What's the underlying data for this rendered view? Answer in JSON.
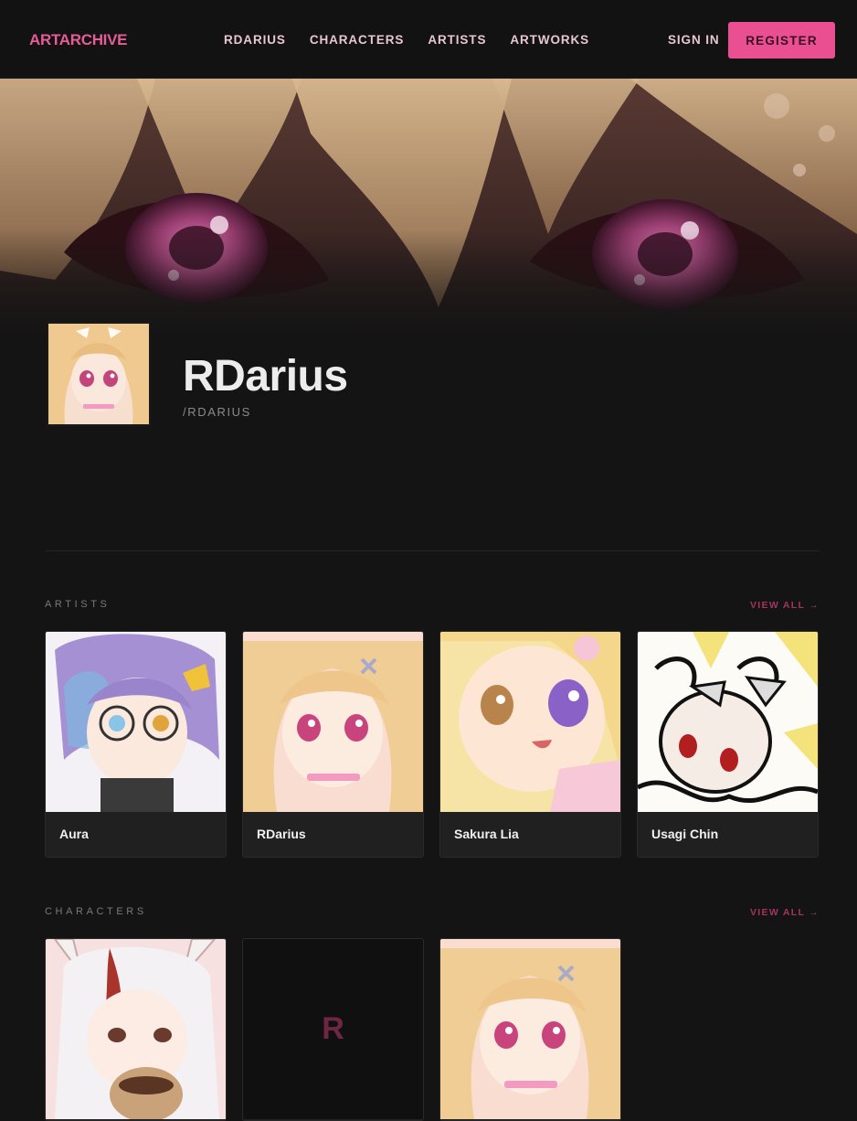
{
  "brand": {
    "name": "ARTARCHIVE",
    "accent": "#ea4f91"
  },
  "nav": {
    "items": [
      {
        "label": "RDARIUS"
      },
      {
        "label": "CHARACTERS"
      },
      {
        "label": "ARTISTS"
      },
      {
        "label": "ARTWORKS"
      }
    ],
    "sign_in": "SIGN IN",
    "register": "REGISTER"
  },
  "banner": {
    "image": "banner-art-eyes"
  },
  "profile": {
    "name": "RDarius",
    "handle": "/RDARIUS",
    "avatar": "rdarius-avatar"
  },
  "artists": {
    "title": "ARTISTS",
    "view_all": "VIEW ALL →",
    "items": [
      {
        "name": "Aura"
      },
      {
        "name": "RDarius"
      },
      {
        "name": "Sakura Lia"
      },
      {
        "name": "Usagi Chin"
      }
    ]
  },
  "characters": {
    "title": "CHARACTERS",
    "view_all": "VIEW ALL →",
    "items": [
      {
        "initial": ""
      },
      {
        "initial": "R"
      },
      {
        "initial": ""
      }
    ]
  }
}
